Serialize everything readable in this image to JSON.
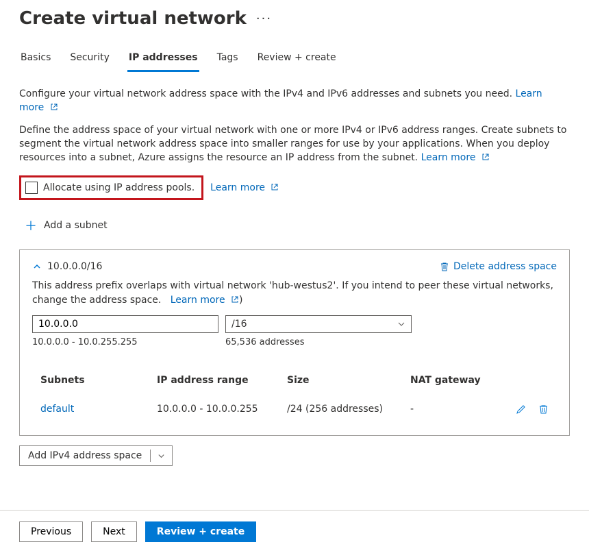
{
  "page": {
    "title": "Create virtual network"
  },
  "tabs": {
    "basics": "Basics",
    "security": "Security",
    "ip": "IP addresses",
    "tags": "Tags",
    "review": "Review + create"
  },
  "text": {
    "intro": "Configure your virtual network address space with the IPv4 and IPv6 addresses and subnets you need.",
    "learn_more": "Learn more",
    "desc": "Define the address space of your virtual network with one or more IPv4 or IPv6 address ranges. Create subnets to segment the virtual network address space into smaller ranges for use by your applications. When you deploy resources into a subnet, Azure assigns the resource an IP address from the subnet.",
    "allocate_label": "Allocate using IP address pools.",
    "add_subnet": "Add a subnet"
  },
  "address_space": {
    "cidr": "10.0.0.0/16",
    "delete_label": "Delete address space",
    "overlap_msg": "This address prefix overlaps with virtual network 'hub-westus2'. If you intend to peer these virtual networks, change the address space.",
    "ip_value": "10.0.0.0",
    "prefix_value": "/16",
    "range": "10.0.0.0 - 10.0.255.255",
    "size": "65,536 addresses",
    "close_paren": ")"
  },
  "subnets": {
    "headers": {
      "name": "Subnets",
      "range": "IP address range",
      "size": "Size",
      "nat": "NAT gateway"
    },
    "row": {
      "name": "default",
      "range": "10.0.0.0 - 10.0.0.255",
      "size": "/24 (256 addresses)",
      "nat": "-"
    }
  },
  "add_space_button": "Add IPv4 address space",
  "footer": {
    "previous": "Previous",
    "next": "Next",
    "review": "Review + create"
  }
}
